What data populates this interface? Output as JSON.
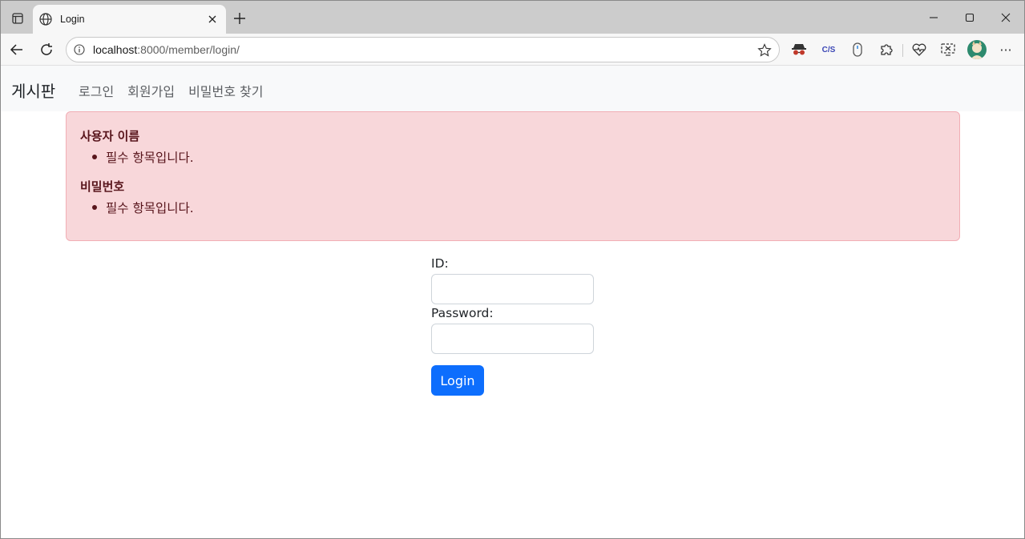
{
  "browser": {
    "tab_title": "Login",
    "url_host": "localhost",
    "url_path": ":8000/member/login/",
    "icons": {
      "tab_actions": "tab-actions-icon",
      "favicon": "globe-icon",
      "close": "close-icon",
      "new_tab": "plus-icon",
      "minimize": "minimize-icon",
      "maximize": "maximize-icon",
      "window_close": "close-icon",
      "back": "back-arrow-icon",
      "reload": "reload-icon",
      "info": "info-icon",
      "favorite": "star-icon",
      "more": "more-icon"
    },
    "extensions": [
      "incognito-extension-icon",
      "css-extension-icon",
      "mouse-extension-icon",
      "puzzle-extension-icon",
      "health-icon",
      "screenshot-icon"
    ],
    "extension_labels": {
      "css": "C/S"
    },
    "more_label": "···"
  },
  "navbar": {
    "brand": "게시판",
    "links": [
      "로그인",
      "회원가입",
      "비밀번호 찾기"
    ]
  },
  "errors": [
    {
      "field": "사용자 이름",
      "messages": [
        "필수 항목입니다."
      ]
    },
    {
      "field": "비밀번호",
      "messages": [
        "필수 항목입니다."
      ]
    }
  ],
  "form": {
    "id_label": "ID:",
    "id_value": "",
    "password_label": "Password:",
    "password_value": "",
    "submit_label": "Login"
  },
  "colors": {
    "alert_bg": "#f8d7da",
    "alert_border": "#f1aeb5",
    "alert_text": "#58151c",
    "primary": "#0d6efd",
    "navbar_bg": "#f8f9fa"
  }
}
